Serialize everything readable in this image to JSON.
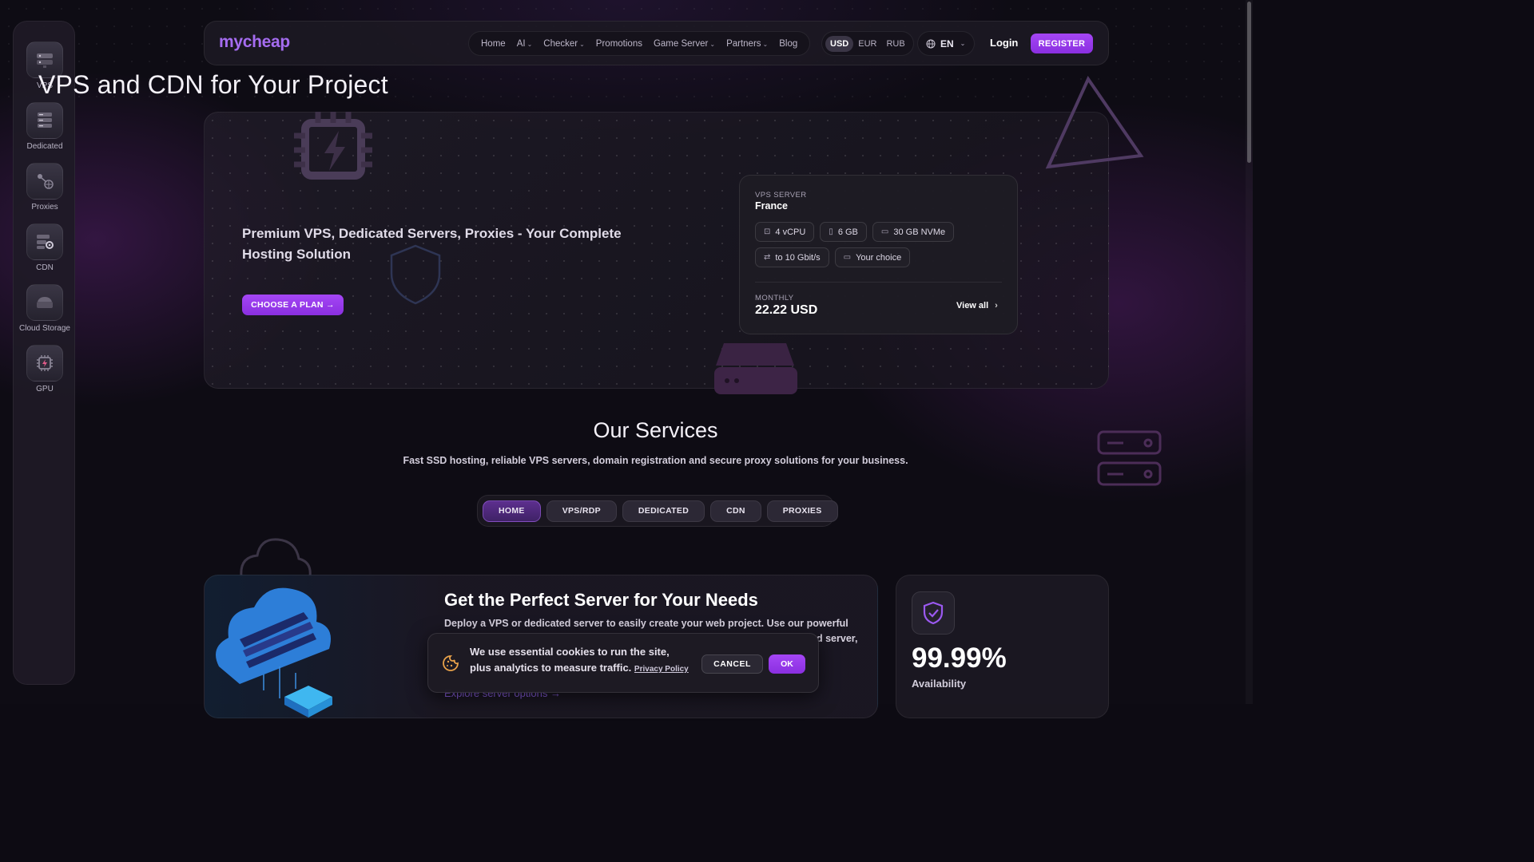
{
  "brand": {
    "logo": "mycheap",
    "accent": "#a546f5"
  },
  "sidebar": {
    "items": [
      {
        "label": "VPS",
        "icon": "server-rack-icon"
      },
      {
        "label": "Dedicated",
        "icon": "dedicated-server-icon"
      },
      {
        "label": "Proxies",
        "icon": "proxy-network-icon"
      },
      {
        "label": "CDN",
        "icon": "cdn-settings-icon"
      },
      {
        "label": "Cloud Storage",
        "icon": "cloud-storage-icon"
      },
      {
        "label": "GPU",
        "icon": "gpu-chip-icon"
      }
    ]
  },
  "nav": {
    "items": [
      {
        "label": "Home",
        "dropdown": false
      },
      {
        "label": "AI",
        "dropdown": true
      },
      {
        "label": "Checker",
        "dropdown": true
      },
      {
        "label": "Promotions",
        "dropdown": false
      },
      {
        "label": "Game Server",
        "dropdown": true
      },
      {
        "label": "Partners",
        "dropdown": true
      },
      {
        "label": "Blog",
        "dropdown": false
      }
    ],
    "currencies": [
      "USD",
      "EUR",
      "RUB"
    ],
    "active_currency": "USD",
    "language": "EN",
    "login": "Login",
    "register": "REGISTER"
  },
  "hero": {
    "title": "VPS and CDN for Your Project",
    "subtitle": "Premium VPS, Dedicated Servers, Proxies - Your Complete Hosting Solution",
    "cta": "CHOOSE A PLAN →",
    "card": {
      "kicker": "VPS SERVER",
      "location": "France",
      "specs": [
        {
          "icon": "cpu-icon",
          "label": "4 vCPU"
        },
        {
          "icon": "memory-icon",
          "label": "6 GB"
        },
        {
          "icon": "disk-icon",
          "label": "30 GB NVMe"
        },
        {
          "icon": "bandwidth-icon",
          "label": "to 10 Gbit/s"
        },
        {
          "icon": "monitor-icon",
          "label": "Your choice"
        }
      ],
      "period_label": "MONTHLY",
      "price": "22.22 USD",
      "view_all": "View all"
    }
  },
  "services": {
    "title": "Our Services",
    "subtitle": "Fast SSD hosting, reliable VPS servers, domain registration and secure proxy solutions for your business.",
    "tabs": [
      "HOME",
      "VPS/RDP",
      "DEDICATED",
      "CDN",
      "PROXIES"
    ],
    "active_tab": "HOME"
  },
  "promo": {
    "title": "Get the Perfect Server for Your Needs",
    "text_line1": "Deploy a VPS or dedicated server to easily create your web project. Use our powerful",
    "text_line2_tail": "d server,",
    "link": "Explore server options →"
  },
  "availability": {
    "value": "99.99%",
    "label": "Availability"
  },
  "cookie": {
    "text": "We use essential cookies to run the site, plus analytics to measure traffic.",
    "policy_link": "Privacy Policy",
    "cancel": "CANCEL",
    "ok": "OK"
  }
}
